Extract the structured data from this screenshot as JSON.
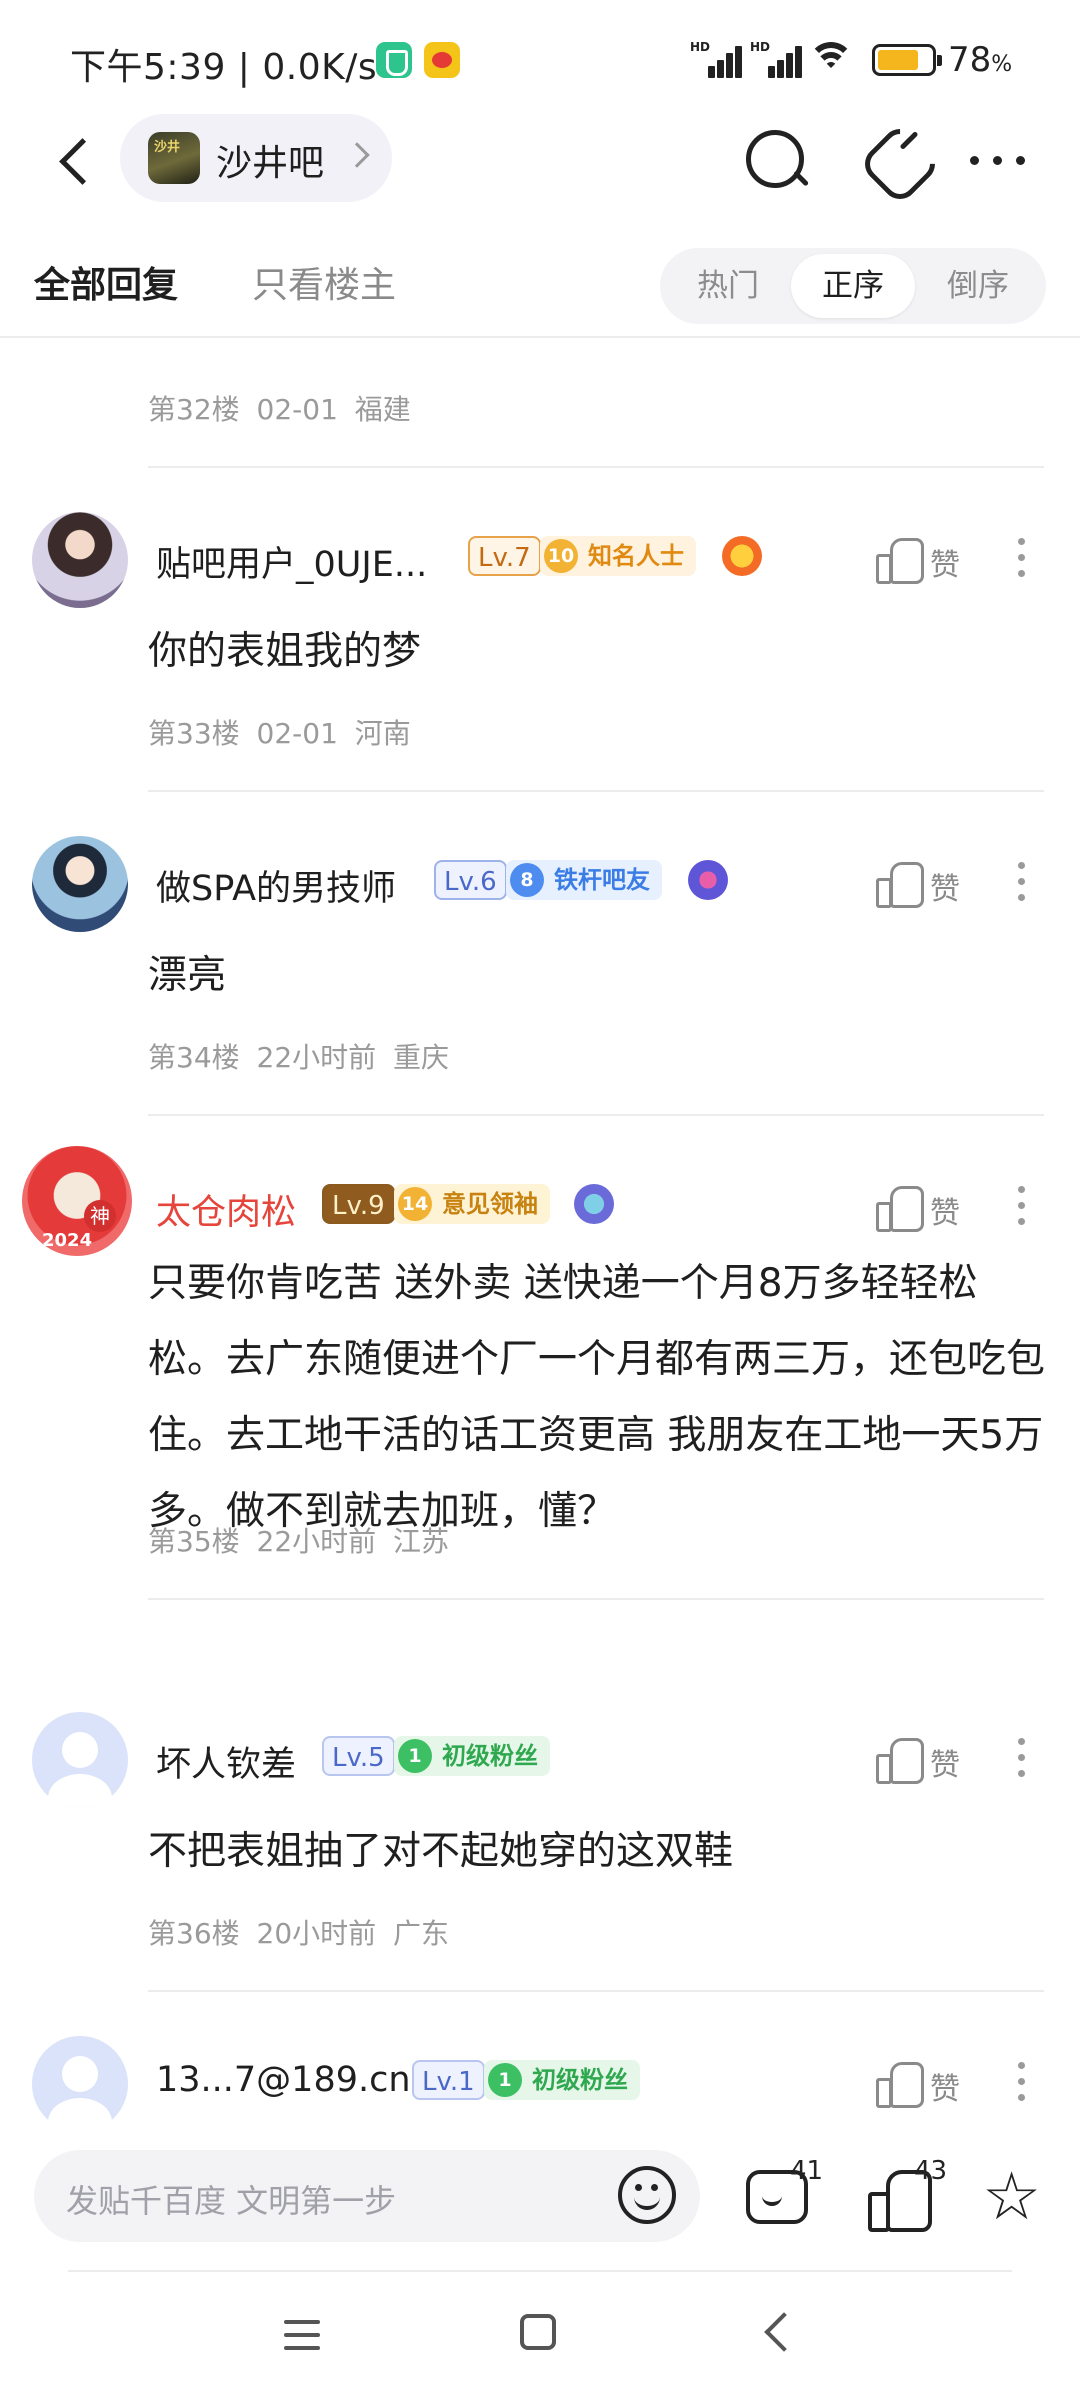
{
  "status_bar": {
    "time_speed": "下午5:39 | 0.0K/s",
    "signal_label_1": "HD",
    "signal_label_2": "HD",
    "battery_pct": "78",
    "battery_unit": "%",
    "battery_level": 0.78,
    "colors": {
      "battery_fill": "#f5b51c"
    }
  },
  "nav": {
    "forum_name": "沙井吧",
    "icons": [
      "back-icon",
      "search-icon",
      "share-icon",
      "more-icon"
    ]
  },
  "tabs": {
    "all_replies": "全部回复",
    "only_op": "只看楼主",
    "sort": [
      "热门",
      "正序",
      "倒序"
    ],
    "active_sort": "正序"
  },
  "feed": {
    "prev_meta": "第32楼 02-01 福建",
    "posts": [
      {
        "user": "贴吧用户_0UJE...",
        "level": "Lv.7",
        "badge_num": "10",
        "badge_text": "知名人士",
        "like_label": "赞",
        "content": "你的表姐我的梦",
        "meta": "第33楼 02-01 河南"
      },
      {
        "user": "做SPA的男技师",
        "level": "Lv.6",
        "badge_num": "8",
        "badge_text": "铁杆吧友",
        "like_label": "赞",
        "content": "漂亮",
        "meta": "第34楼 22小时前 重庆"
      },
      {
        "user": "太仓肉松",
        "level": "Lv.9",
        "badge_num": "14",
        "badge_text": "意见领袖",
        "avatar_frame_text": "神",
        "avatar_year": "2024",
        "like_label": "赞",
        "content": "只要你肯吃苦 送外卖 送快递一个月8万多轻轻松松。去广东随便进个厂一个月都有两三万，还包吃包住。去工地干活的话工资更高 我朋友在工地一天5万多。做不到就去加班，懂？",
        "meta": "第35楼 22小时前 江苏"
      },
      {
        "user": "坏人钦差",
        "level": "Lv.5",
        "badge_num": "1",
        "badge_text": "初级粉丝",
        "like_label": "赞",
        "content": "不把表姐抽了对不起她穿的这双鞋",
        "meta": "第36楼 20小时前 广东"
      },
      {
        "user": "13...7@189.cn",
        "level": "Lv.1",
        "badge_num": "1",
        "badge_text": "初级粉丝",
        "like_label": "赞"
      }
    ]
  },
  "bottom_bar": {
    "input_placeholder": "发贴千百度 文明第一步",
    "comment_count": "41",
    "like_count": "43"
  }
}
